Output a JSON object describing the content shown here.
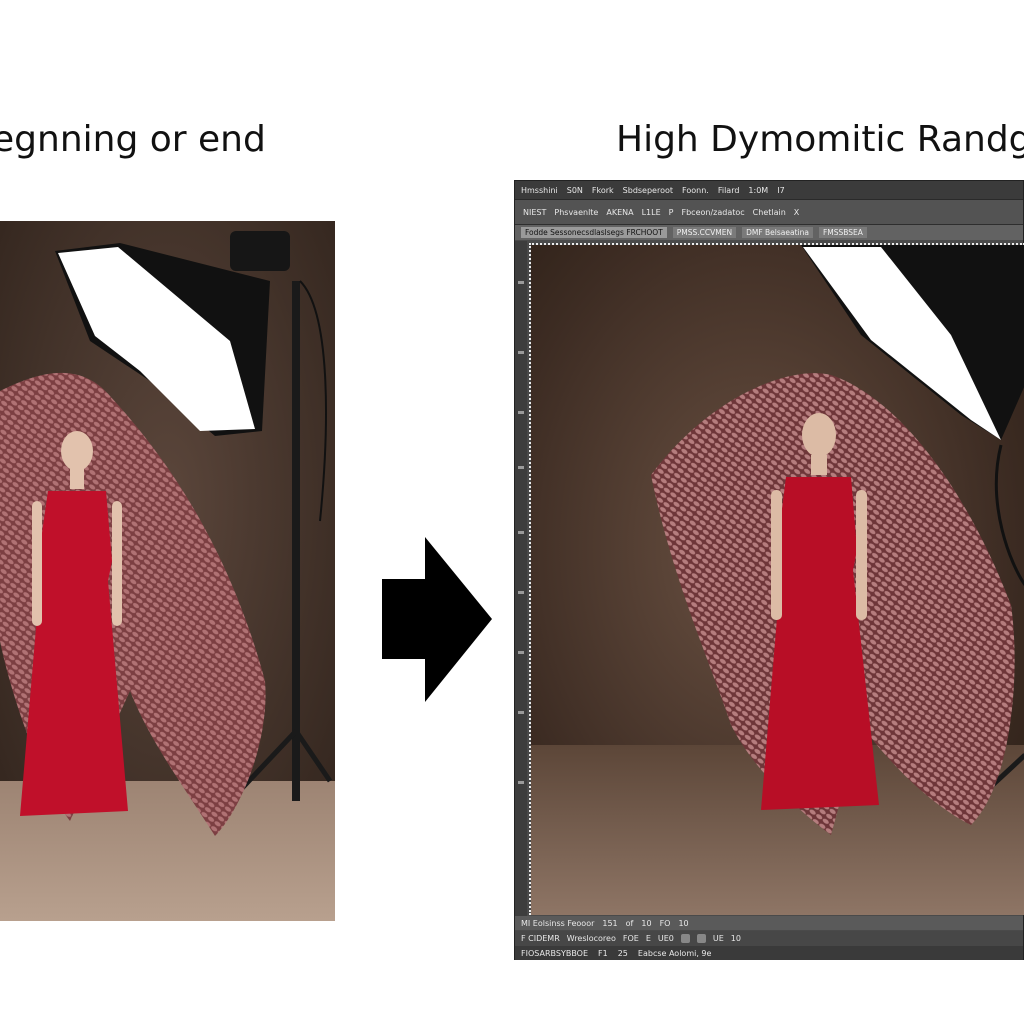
{
  "captions": {
    "left": "egnning or end",
    "right": "High Dymomitic Randge"
  },
  "editor": {
    "menu": [
      "Hmsshini",
      "S0N",
      "Fkork",
      "Sbdseperoot",
      "Foonn.",
      "Filard",
      "1:0M",
      "I7"
    ],
    "options": [
      "NIEST",
      "Phsvaenlte",
      "AKENA",
      "L1LE",
      "P",
      "Fbceon/zadatoc",
      "Chetlain",
      "X"
    ],
    "tabs": [
      "Fodde Sessonecsdlaslsegs FRCHOOT",
      "PMSS.CCVMEN",
      "DMF Belsaeatina",
      "FMSSBSEA"
    ],
    "status": [
      "MI Eolsinss Feooor",
      "151",
      "of",
      "10",
      "FO",
      "10"
    ],
    "bottom1": [
      "F CIDEMR",
      "Wreslocoreo",
      "FOE",
      "E",
      "UE0",
      "UE",
      "10"
    ],
    "bottom2": [
      "FIOSARBSYBBOE",
      "F1",
      "25",
      "Eabcse Aolomi, 9e"
    ]
  },
  "colors": {
    "backdrop": "#3a2a22",
    "dress": "#c0102a",
    "fabric": "#8a4a4c",
    "editor_chrome": "#4a4a4a"
  },
  "icons": [
    "right-arrow-icon",
    "softbox-icon",
    "light-stand-icon"
  ]
}
